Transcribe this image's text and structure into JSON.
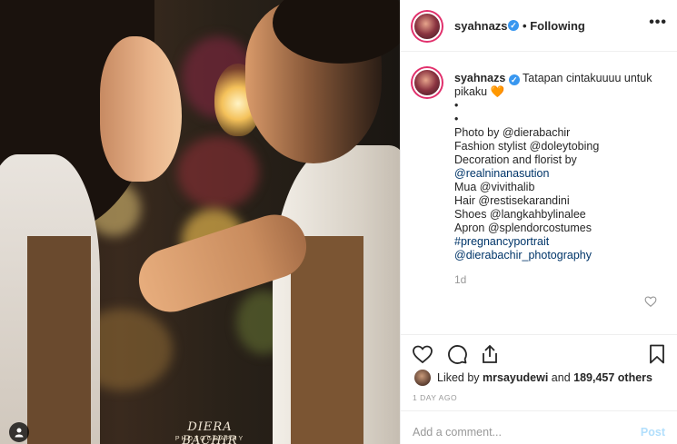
{
  "photo": {
    "watermark": "DIERA BACHIR",
    "watermark_sub": "PHOTOGRAPHY"
  },
  "header": {
    "username": "syahnazs",
    "separator": "•",
    "follow_label": "Following",
    "more_label": "•••"
  },
  "caption": {
    "username": "syahnazs",
    "lines": [
      "Tatapan cintakuuuu untuk",
      "pikaku",
      "•",
      "•",
      "Photo by @dierabachir",
      "Fashion stylist @doleytobing",
      "Decoration and florist by",
      "@realninanasution",
      "Mua @vivithalib",
      "Hair @restisekarandini",
      "Shoes @langkahbylinalee",
      "Apron @splendorcostumes",
      "#pregnancyportrait",
      "@dierabachir_photography"
    ],
    "emoji": "🧡",
    "age": "1d"
  },
  "actions": {
    "icons": [
      "heart-icon",
      "comment-icon",
      "share-icon",
      "bookmark-icon"
    ]
  },
  "likes": {
    "prefix": "Liked by",
    "user": "mrsayudewi",
    "connector": "and",
    "count": "189,457 others"
  },
  "time": "1 DAY AGO",
  "comment": {
    "placeholder": "Add a comment...",
    "post_label": "Post"
  },
  "colors": {
    "verified": "#3897f0",
    "story_ring": "#e1306c",
    "post_disabled": "#b2dffc",
    "muted": "#999999"
  }
}
